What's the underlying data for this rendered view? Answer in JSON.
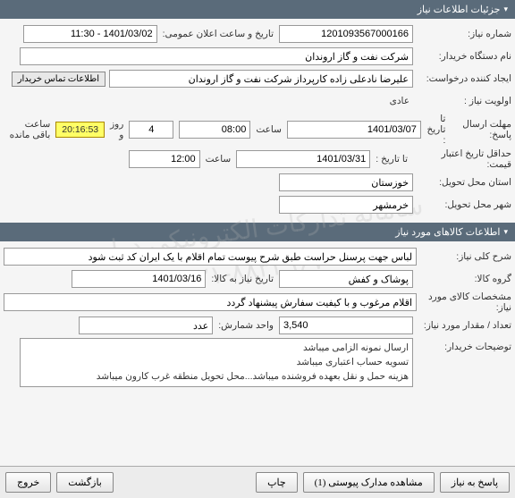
{
  "watermark": {
    "line1": "سامانه تدارکات الکترونیکی دولت",
    "line2": "۰۲۱-۸۸۳۴۹۶۷۰"
  },
  "section1": {
    "title": "جزئیات اطلاعات نیاز"
  },
  "need": {
    "number_label": "شماره نیاز:",
    "number": "1201093567000166",
    "announce_label": "تاریخ و ساعت اعلان عمومی:",
    "announce_value": "1401/03/02 - 11:30",
    "buyer_label": "نام دستگاه خریدار:",
    "buyer": "شرکت نفت و گاز اروندان",
    "creator_label": "ایجاد کننده درخواست:",
    "creator": "علیرضا نادعلی زاده کارپرداز شرکت نفت و گاز اروندان",
    "contact_btn": "اطلاعات تماس خریدار",
    "priority_label": "اولویت نیاز :",
    "priority": "عادی",
    "deadline_label": "مهلت ارسال پاسخ:",
    "to_date_label": "تا تاریخ :",
    "deadline_date": "1401/03/07",
    "time_label": "ساعت",
    "deadline_time": "08:00",
    "days": "4",
    "days_and": "روز و",
    "remaining_time": "20:16:53",
    "remaining_text": "ساعت باقی مانده",
    "validity_label": "حداقل تاریخ اعتبار قیمت:",
    "validity_date": "1401/03/31",
    "validity_time": "12:00",
    "province_label": "استان محل تحویل:",
    "province": "خوزستان",
    "city_label": "شهر محل تحویل:",
    "city": "خرمشهر"
  },
  "section2": {
    "title": "اطلاعات کالاهای مورد نیاز"
  },
  "goods": {
    "desc_label": "شرح کلی نیاز:",
    "desc": "لباس جهت پرسنل حراست طبق شرح پیوست تمام اقلام با یک ایران کد ثبت شود",
    "group_label": "گروه کالا:",
    "group": "پوشاک و کفش",
    "need_date_label": "تاریخ نیاز به کالا:",
    "need_date": "1401/03/16",
    "spec_label": "مشخصات کالای مورد نیاز:",
    "spec": "اقلام مرغوب و با کیفیت سفارش پیشنهاد گردد",
    "qty_label": "تعداد / مقدار مورد نیاز:",
    "qty": "3,540",
    "unit_label": "واحد شمارش:",
    "unit": "عدد",
    "notes_label": "توضیحات خریدار:",
    "notes_l1": "ارسال نمونه الزامی میباشد",
    "notes_l2": "تسویه حساب اعتباری میباشد",
    "notes_l3": "هزینه حمل و نقل بعهده فروشنده میباشد...محل تحویل منطقه غرب کارون میباشد"
  },
  "footer": {
    "respond": "پاسخ به نیاز",
    "attachments": "مشاهده مدارک پیوستی (1)",
    "print": "چاپ",
    "back": "بازگشت",
    "exit": "خروج"
  }
}
